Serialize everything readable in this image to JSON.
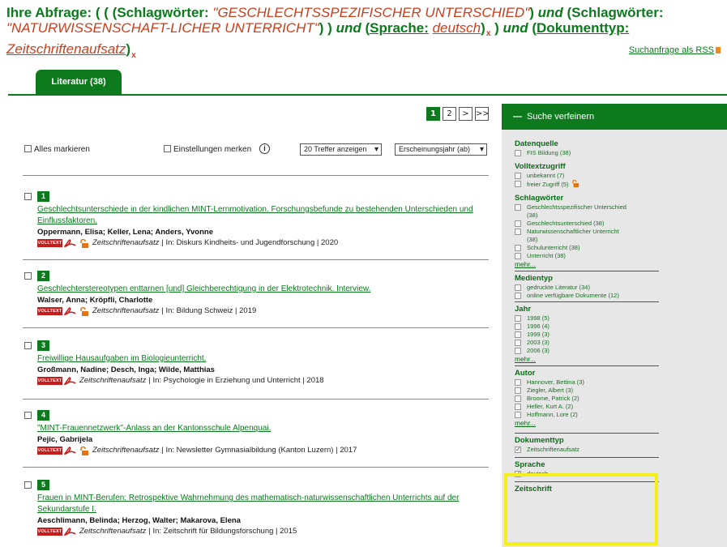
{
  "query": {
    "prefix": "Ihre Abfrage: ( ( (Schlagwörter: ",
    "term1": "\"GESCHLECHTSSPEZIFISCHER UNTERSCHIED\"",
    "mid1": ") ",
    "and1": "und",
    "mid2": " (Schlagwörter: ",
    "term2": "\"NATURWISSENSCHAFT-LICHER UNTERRICHT\"",
    "mid3": ") ) ",
    "and2": "und",
    "mid4": " (",
    "lang_label": "Sprache:",
    "lang_value": "deutsch",
    "close_lang": ")",
    "remove": "x",
    "mid5": " ) ",
    "and3": "und",
    "mid6": " (",
    "doctype_label": "Dokumenttyp:",
    "doctype_value": "Zeitschriftenaufsatz",
    "close_doc": ")"
  },
  "rss_link": "Suchanfrage als RSS",
  "tabs": [
    {
      "label": "Literatur (38)"
    }
  ],
  "pagination": {
    "current": "1",
    "next_page": "2",
    "next": ">",
    "last": ">>"
  },
  "controls": {
    "mark_all": "Alles markieren",
    "save_settings": "Einstellungen merken",
    "info": "i",
    "per_page": "20 Treffer anzeigen",
    "sort": "Erscheinungsjahr (ab)"
  },
  "badge_label": "VOLLTEXT",
  "results": [
    {
      "num": "1",
      "title": "Geschlechtsunterschiede in der kindlichen MINT-Lernmotivation. Forschungsbefunde zu bestehenden Unterschieden und Einflussfaktoren.",
      "authors": "Oppermann, Elisa; Keller, Lena; Anders, Yvonne",
      "type": "Zeitschriftenaufsatz",
      "source": "| In: Diskurs Kindheits- und Jugendforschung | 2020"
    },
    {
      "num": "2",
      "title": "Geschlechterstereotypen enttarnen [und] Gleichberechtigung in der Elektrotechnik. Interview.",
      "authors": "Walser, Anna; Kröpfli, Charlotte",
      "type": "Zeitschriftenaufsatz",
      "source": "| In: Bildung Schweiz | 2019"
    },
    {
      "num": "3",
      "title": "Freiwillige Hausaufgaben im Biologieunterricht.",
      "authors": "Großmann, Nadine; Desch, Inga; Wilde, Matthias",
      "type": "Zeitschriftenaufsatz",
      "source": "| In: Psychologie in Erziehung und Unterricht | 2018"
    },
    {
      "num": "4",
      "title": "\"MINT-Frauennetzwerk\"-Anlass an der Kantonsschule Alpenquai.",
      "authors": "Pejic, Gabrijela",
      "type": "Zeitschriftenaufsatz",
      "source": "| In: Newsletter Gymnasialbildung (Kanton Luzern) | 2017"
    },
    {
      "num": "5",
      "title": "Frauen in MINT-Berufen: Retrospektive Wahrnehmung des mathematisch-naturwissenschaftlichen Unterrichts auf der Sekundarstufe I.",
      "authors": "Aeschlimann, Belinda; Herzog, Walter; Makarova, Elena",
      "type": "Zeitschriftenaufsatz",
      "source": "| In: Zeitschrift für Bildungsforschung | 2015"
    }
  ],
  "sidebar": {
    "header": "Suche verfeinern",
    "more": "mehr...",
    "facets": [
      {
        "title": "Datenquelle",
        "items": [
          "FIS Bildung (38)"
        ]
      },
      {
        "title": "Volltextzugriff",
        "items": [
          "unbekannt (7)",
          "freier Zugriff (5)"
        ]
      },
      {
        "title": "Schlagwörter",
        "items": [
          "Geschlechtsspezifischer Unterschied",
          "(38)",
          "Geschlechtsunterschied (38)",
          "Naturwissenschaftlicher Unterricht",
          "(38)",
          "Schulunterricht (38)",
          "Unterricht (38)"
        ]
      },
      {
        "title": "Medientyp",
        "items": [
          "gedruckte Literatur (34)",
          "online verfügbare Dokumente (12)"
        ]
      },
      {
        "title": "Jahr",
        "items": [
          "1998 (5)",
          "1996 (4)",
          "1999 (3)",
          "2003 (3)",
          "2006 (3)"
        ]
      },
      {
        "title": "Autor",
        "items": [
          "Hannover, Bettina (3)",
          "Ziegler, Albert (3)",
          "Broome, Patrick (2)",
          "Heller, Kurt A. (2)",
          "Hoffmann, Lore (2)"
        ]
      },
      {
        "title": "Dokumenttyp",
        "items": [
          "Zeitschriftenaufsatz"
        ]
      },
      {
        "title": "Sprache",
        "items": [
          "deutsch"
        ]
      },
      {
        "title": "Zeitschrift",
        "items": []
      }
    ]
  },
  "colors": {
    "brand_green": "#0c7a1d",
    "query_red": "#cc3d1a",
    "highlight_yellow": "#f4ef19",
    "volltext_red": "#c31e1e"
  }
}
